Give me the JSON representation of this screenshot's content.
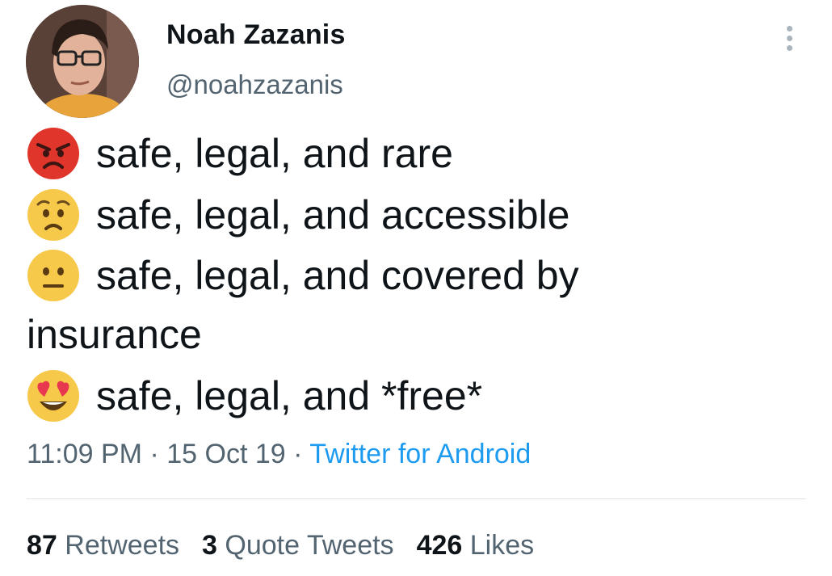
{
  "author": {
    "display_name": "Noah Zazanis",
    "handle": "@noahzazanis"
  },
  "body_lines": [
    {
      "emoji": "angry-face-icon",
      "text": "safe, legal, and rare"
    },
    {
      "emoji": "worried-face-icon",
      "text": "safe, legal, and accessible"
    },
    {
      "emoji": "neutral-face-icon",
      "text": "safe, legal, and covered by"
    },
    {
      "emoji": null,
      "text": "insurance"
    },
    {
      "emoji": "heart-eyes-face-icon",
      "text": "safe, legal, and *free*"
    }
  ],
  "meta": {
    "time": "11:09 PM",
    "separator": " · ",
    "date": "15 Oct 19",
    "source": "Twitter for Android"
  },
  "stats": {
    "retweets_count": "87",
    "retweets_label": "Retweets",
    "quotes_count": "3",
    "quotes_label": "Quote Tweets",
    "likes_count": "426",
    "likes_label": "Likes"
  },
  "colors": {
    "link": "#1d9bf0",
    "secondary_text": "#536471",
    "angry_red": "#e0352b",
    "emoji_yellow": "#f7c94a"
  }
}
